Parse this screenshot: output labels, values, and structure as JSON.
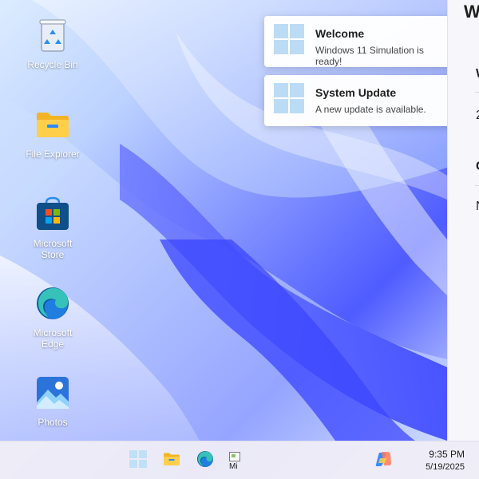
{
  "desktop": {
    "icons": [
      {
        "label": "Recycle Bin",
        "icon": "recycle-bin-icon"
      },
      {
        "label": "File Explorer",
        "icon": "file-explorer-icon"
      },
      {
        "label": "Microsoft\nStore",
        "icon": "microsoft-store-icon"
      },
      {
        "label": "Microsoft\nEdge",
        "icon": "microsoft-edge-icon"
      },
      {
        "label": "Photos",
        "icon": "photos-icon"
      }
    ]
  },
  "notifications": [
    {
      "title": "Welcome",
      "body": "Windows 11 Simulation is ready!",
      "icon": "windows-logo-icon"
    },
    {
      "title": "System Update",
      "body": "A new update is available.",
      "icon": "windows-logo-icon"
    }
  ],
  "side_panel": {
    "title": "W",
    "rows": [
      {
        "text": "W",
        "bold": true
      },
      {
        "text": "2",
        "bold": false
      },
      {
        "text": "C",
        "bold": true
      },
      {
        "text": "N",
        "bold": false
      }
    ]
  },
  "taskbar": {
    "start_icon": "windows-start-icon",
    "pinned": [
      "file-explorer-icon",
      "microsoft-edge-icon",
      "broken-image-icon"
    ],
    "broken_image_alt": "Mi",
    "copilot_icon": "copilot-icon",
    "time": "9:35 PM",
    "date": "5/19/2025"
  },
  "colors": {
    "windows_blue": "#0078D4",
    "notification_bg": "#FFFFFF",
    "taskbar_bg": "#F1EFF7"
  }
}
